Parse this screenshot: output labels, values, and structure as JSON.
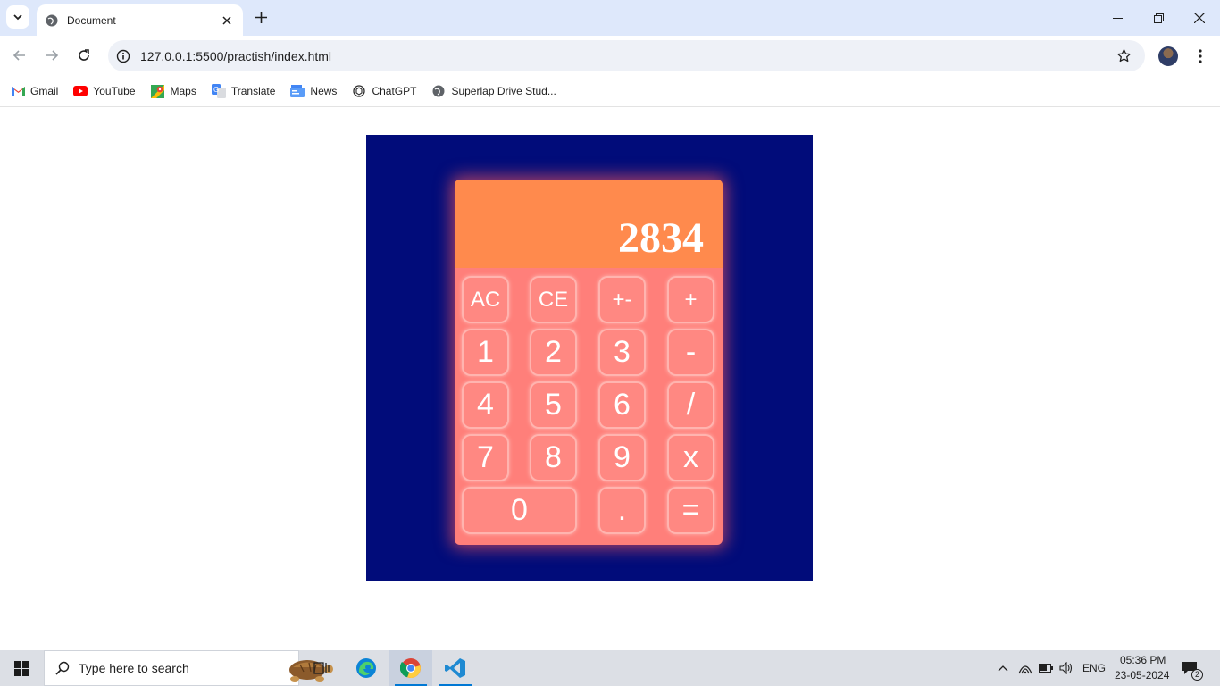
{
  "browser": {
    "tab_title": "Document",
    "url": "127.0.0.1:5500/practish/index.html",
    "bookmarks": [
      {
        "label": "Gmail",
        "icon": "gmail-icon"
      },
      {
        "label": "YouTube",
        "icon": "youtube-icon"
      },
      {
        "label": "Maps",
        "icon": "maps-icon"
      },
      {
        "label": "Translate",
        "icon": "translate-icon"
      },
      {
        "label": "News",
        "icon": "news-icon"
      },
      {
        "label": "ChatGPT",
        "icon": "chatgpt-icon"
      },
      {
        "label": "Superlap Drive Stud...",
        "icon": "globe-icon"
      }
    ]
  },
  "calculator": {
    "display": "2834",
    "keys": {
      "ac": "AC",
      "ce": "CE",
      "sign": "+-",
      "add": "+",
      "one": "1",
      "two": "2",
      "three": "3",
      "subtract": "-",
      "four": "4",
      "five": "5",
      "six": "6",
      "divide": "/",
      "seven": "7",
      "eight": "8",
      "nine": "9",
      "multiply": "x",
      "zero": "0",
      "decimal": ".",
      "equals": "="
    },
    "colors": {
      "background": "#010c7a",
      "body": "#ff7f7a",
      "display": "#ff8a4d",
      "text": "#ffffff"
    }
  },
  "taskbar": {
    "search_placeholder": "Type here to search",
    "language": "ENG",
    "time": "05:36 PM",
    "date": "23-05-2024",
    "notification_count": "2"
  }
}
